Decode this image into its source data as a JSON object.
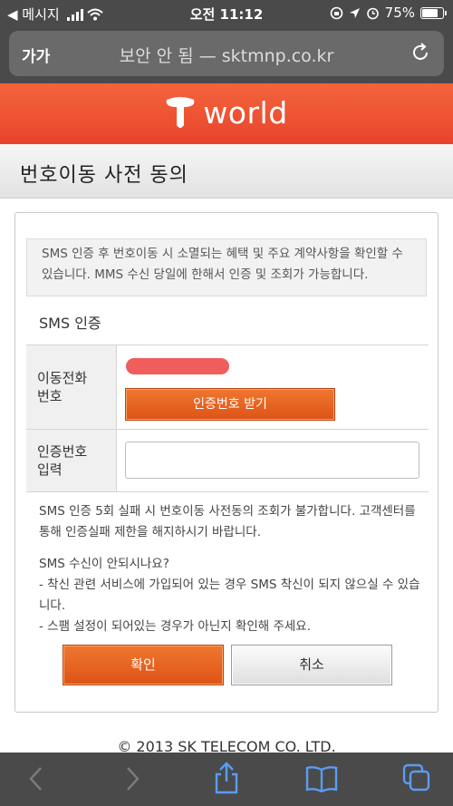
{
  "status_bar": {
    "back_label": "◀ 메시지",
    "time": "오전 11:12",
    "battery": "75%"
  },
  "address_bar": {
    "text_size": "가가",
    "url": "보안 안 됨 — sktmnp.co.kr"
  },
  "brand": {
    "logo_text": "world"
  },
  "page": {
    "title": "번호이동 사전 동의"
  },
  "notice": "SMS 인증 후 번호이동 시 소멸되는 혜택 및 주요 계약사항을 확인할 수 있습니다. MMS 수신 당일에 한해서 인증 및 조회가 가능합니다.",
  "sms": {
    "section_title": "SMS 인증",
    "phone_label_1": "이동전화",
    "phone_label_2": "번호",
    "get_code_button": "인증번호 받기",
    "code_label_1": "인증번호",
    "code_label_2": "입력",
    "code_value": ""
  },
  "info": {
    "limit": "SMS 인증 5회 실패 시 번호이동 사전동의 조회가 불가합니다. 고객센터를 통해 인증실패 제한을 해지하시기 바랍니다.",
    "faq_title": "SMS 수신이 안되시나요?",
    "faq_1": "- 착신 관련 서비스에 가입되어 있는 경우 SMS 착신이 되지 않으실 수 있습니다.",
    "faq_2": "- 스팸 설정이 되어있는 경우가 아닌지 확인해 주세요."
  },
  "buttons": {
    "confirm": "확인",
    "cancel": "취소"
  },
  "footer": {
    "copyright": "© 2013 SK TELECOM CO. LTD."
  },
  "colors": {
    "brand": "#e8442b",
    "button_orange": "#e8601f",
    "phone_mask": "#ef5d5d"
  },
  "toolbar_icons": [
    "back-icon",
    "forward-icon",
    "share-icon",
    "bookmarks-icon",
    "tabs-icon"
  ]
}
